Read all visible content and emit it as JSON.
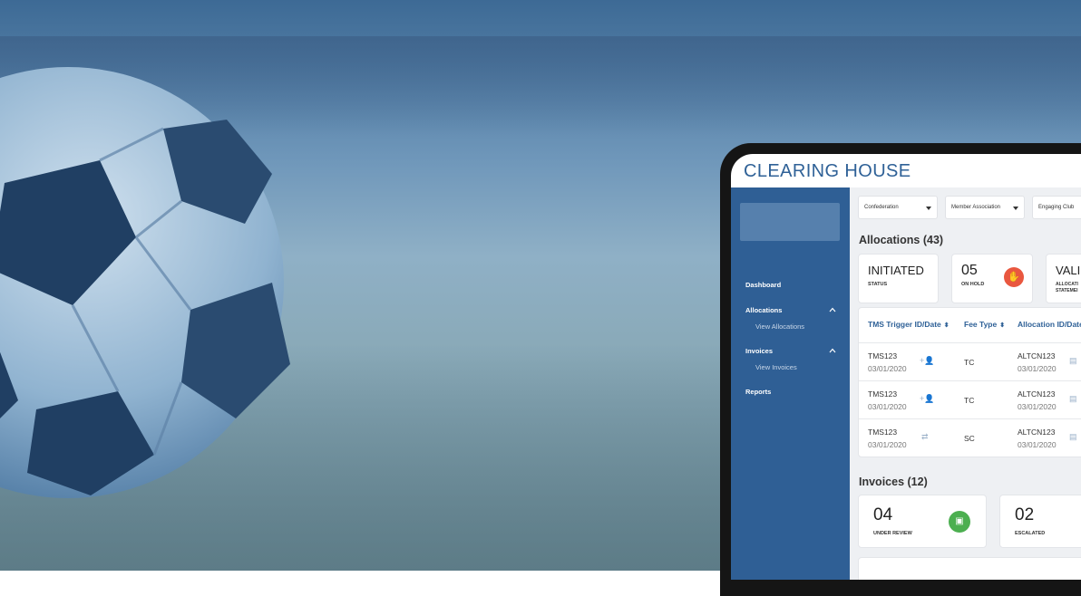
{
  "app": {
    "title": "CLEARING HOUSE"
  },
  "sidebar": {
    "items": [
      {
        "label": "Dashboard",
        "level": 0
      },
      {
        "label": "Allocations",
        "level": 0,
        "expanded": true
      },
      {
        "label": "View Allocations",
        "level": 1
      },
      {
        "label": "Invoices",
        "level": 0,
        "expanded": true
      },
      {
        "label": "View Invoices",
        "level": 1
      },
      {
        "label": "Reports",
        "level": 0
      }
    ]
  },
  "filters": [
    {
      "label": "Confederation"
    },
    {
      "label": "Member Association"
    },
    {
      "label": "Engaging Club"
    }
  ],
  "allocations": {
    "title": "Allocations (43)",
    "cards": [
      {
        "value": "INITIATED",
        "label": "STATUS"
      },
      {
        "value": "05",
        "label": "ON HOLD",
        "icon": "hand-stop-icon",
        "color": "#e9573f"
      },
      {
        "value": "VALI",
        "label": "ALLOCATI STATEMEI"
      }
    ],
    "table": {
      "columns": [
        "TMS Trigger ID/Date",
        "Fee Type",
        "Allocation ID/Date"
      ],
      "rows": [
        {
          "tms_id": "TMS123",
          "tms_date": "03/01/2020",
          "icon": "add-person-icon",
          "fee_type": "TC",
          "alloc_id": "ALTCN123",
          "alloc_date": "03/01/2020"
        },
        {
          "tms_id": "TMS123",
          "tms_date": "03/01/2020",
          "icon": "add-person-icon",
          "fee_type": "TC",
          "alloc_id": "ALTCN123",
          "alloc_date": "03/01/2020"
        },
        {
          "tms_id": "TMS123",
          "tms_date": "03/01/2020",
          "icon": "transfer-arrows-icon",
          "fee_type": "SC",
          "alloc_id": "ALTCN123",
          "alloc_date": "03/01/2020"
        }
      ]
    }
  },
  "invoices": {
    "title": "Invoices (12)",
    "cards": [
      {
        "value": "04",
        "label": "UNDER REVIEW",
        "icon": "review-chat-icon",
        "color": "#4caf50"
      },
      {
        "value": "02",
        "label": "ESCALATED"
      }
    ]
  },
  "colors": {
    "brand": "#2f6197",
    "sidebar": "#2f5f95",
    "on_hold": "#e9573f",
    "review": "#4caf50"
  }
}
